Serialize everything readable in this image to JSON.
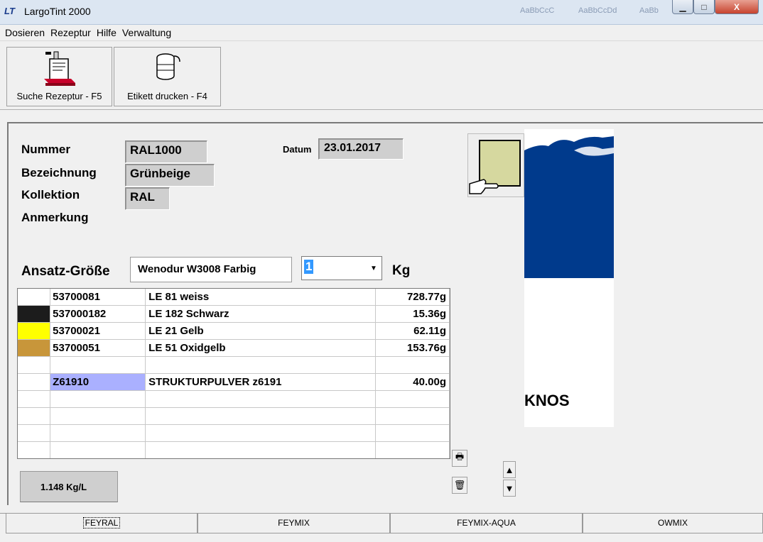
{
  "window": {
    "logo": "LT",
    "title": "LargoTint 2000",
    "background_ghost_text": [
      "AaBbCcC",
      "AaBbCcDd",
      "AaBb"
    ],
    "controls": {
      "minimize": "▁",
      "maximize": "□",
      "close": "X"
    }
  },
  "menu": [
    "Dosieren",
    "Rezeptur",
    "Hilfe",
    "Verwaltung"
  ],
  "toolbar": {
    "search_label": "Suche Rezeptur - F5",
    "print_label": "Etikett drucken - F4"
  },
  "recipe": {
    "labels": {
      "nummer": "Nummer",
      "bezeichnung": "Bezeichnung",
      "kollektion": "Kollektion",
      "anmerkung": "Anmerkung",
      "datum": "Datum"
    },
    "nummer": "RAL1000",
    "bezeichnung": "Grünbeige",
    "kollektion": "RAL",
    "anmerkung": "",
    "datum": "23.01.2017",
    "swatch_color": "#d6d89f"
  },
  "ansatz": {
    "label": "Ansatz-Größe",
    "product": "Wenodur W3008 Farbig",
    "quantity": "1",
    "unit": "Kg"
  },
  "ingredients": [
    {
      "color": "#ffffff",
      "code": "53700081",
      "name": "LE 81 weiss",
      "amount": "728.77g",
      "highlight": false
    },
    {
      "color": "#1c1c1c",
      "code": "537000182",
      "name": "LE 182 Schwarz",
      "amount": "15.36g",
      "highlight": false
    },
    {
      "color": "#ffff00",
      "code": "53700021",
      "name": "LE 21 Gelb",
      "amount": "62.11g",
      "highlight": false
    },
    {
      "color": "#c8963a",
      "code": "53700051",
      "name": "LE 51 Oxidgelb",
      "amount": "153.76g",
      "highlight": false
    },
    {
      "color": "#ffffff",
      "code": "",
      "name": "",
      "amount": "",
      "highlight": false
    },
    {
      "color": "#ffffff",
      "code": "Z61910",
      "name": "STRUKTURPULVER z6191",
      "amount": "40.00g",
      "highlight": true
    },
    {
      "color": "#ffffff",
      "code": "",
      "name": "",
      "amount": "",
      "highlight": false
    },
    {
      "color": "#ffffff",
      "code": "",
      "name": "",
      "amount": "",
      "highlight": false
    },
    {
      "color": "#ffffff",
      "code": "",
      "name": "",
      "amount": "",
      "highlight": false
    },
    {
      "color": "#ffffff",
      "code": "",
      "name": "",
      "amount": "",
      "highlight": false
    }
  ],
  "density": "1.148 Kg/L",
  "logo_text": "KNOS",
  "tabs": [
    "FEYRAL",
    "FEYMIX",
    "FEYMIX-AQUA",
    "OWMIX"
  ],
  "active_tab": "FEYRAL",
  "colors": {
    "highlight_code_bg": "#aab0ff",
    "logo_blue": "#003a8c",
    "qty_select": "#3399ff"
  }
}
